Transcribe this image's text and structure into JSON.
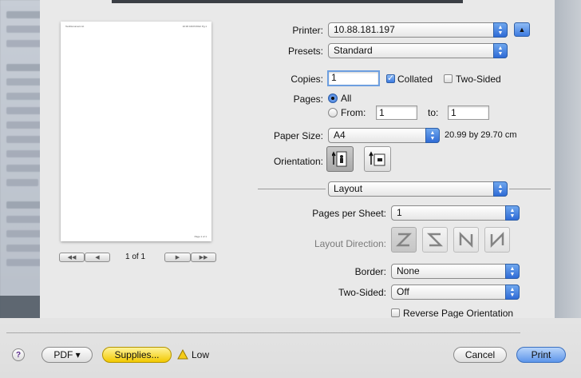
{
  "printer": {
    "label": "Printer:",
    "value": "10.88.181.197",
    "expand_icon": "triangle-up-icon"
  },
  "presets": {
    "label": "Presets:",
    "value": "Standard"
  },
  "copies": {
    "label": "Copies:",
    "value": "1",
    "collated_label": "Collated",
    "collated_checked": true,
    "two_sided_label": "Two-Sided",
    "two_sided_checked": false
  },
  "pages": {
    "label": "Pages:",
    "all_label": "All",
    "from_label": "From:",
    "from_value": "1",
    "to_label": "to:",
    "to_value": "1"
  },
  "paper_size": {
    "label": "Paper Size:",
    "value": "A4",
    "dimensions": "20.99 by 29.70 cm"
  },
  "orientation": {
    "label": "Orientation:"
  },
  "section_popup": {
    "value": "Layout"
  },
  "layout": {
    "pages_per_sheet_label": "Pages per Sheet:",
    "pages_per_sheet_value": "1",
    "layout_direction_label": "Layout Direction:",
    "border_label": "Border:",
    "border_value": "None",
    "two_sided_label": "Two-Sided:",
    "two_sided_value": "Off",
    "reverse_label": "Reverse Page Orientation",
    "reverse_checked": false
  },
  "preview": {
    "page_indicator": "1 of 1",
    "header_left": "TextDocument.txt",
    "header_right": "10:36  16/07/2012  Pg 1",
    "footer": "Page 1 of 1"
  },
  "bottom": {
    "help": "?",
    "pdf_label": "PDF ▾",
    "supplies_label": "Supplies...",
    "low_label": "Low",
    "cancel_label": "Cancel",
    "print_label": "Print"
  }
}
